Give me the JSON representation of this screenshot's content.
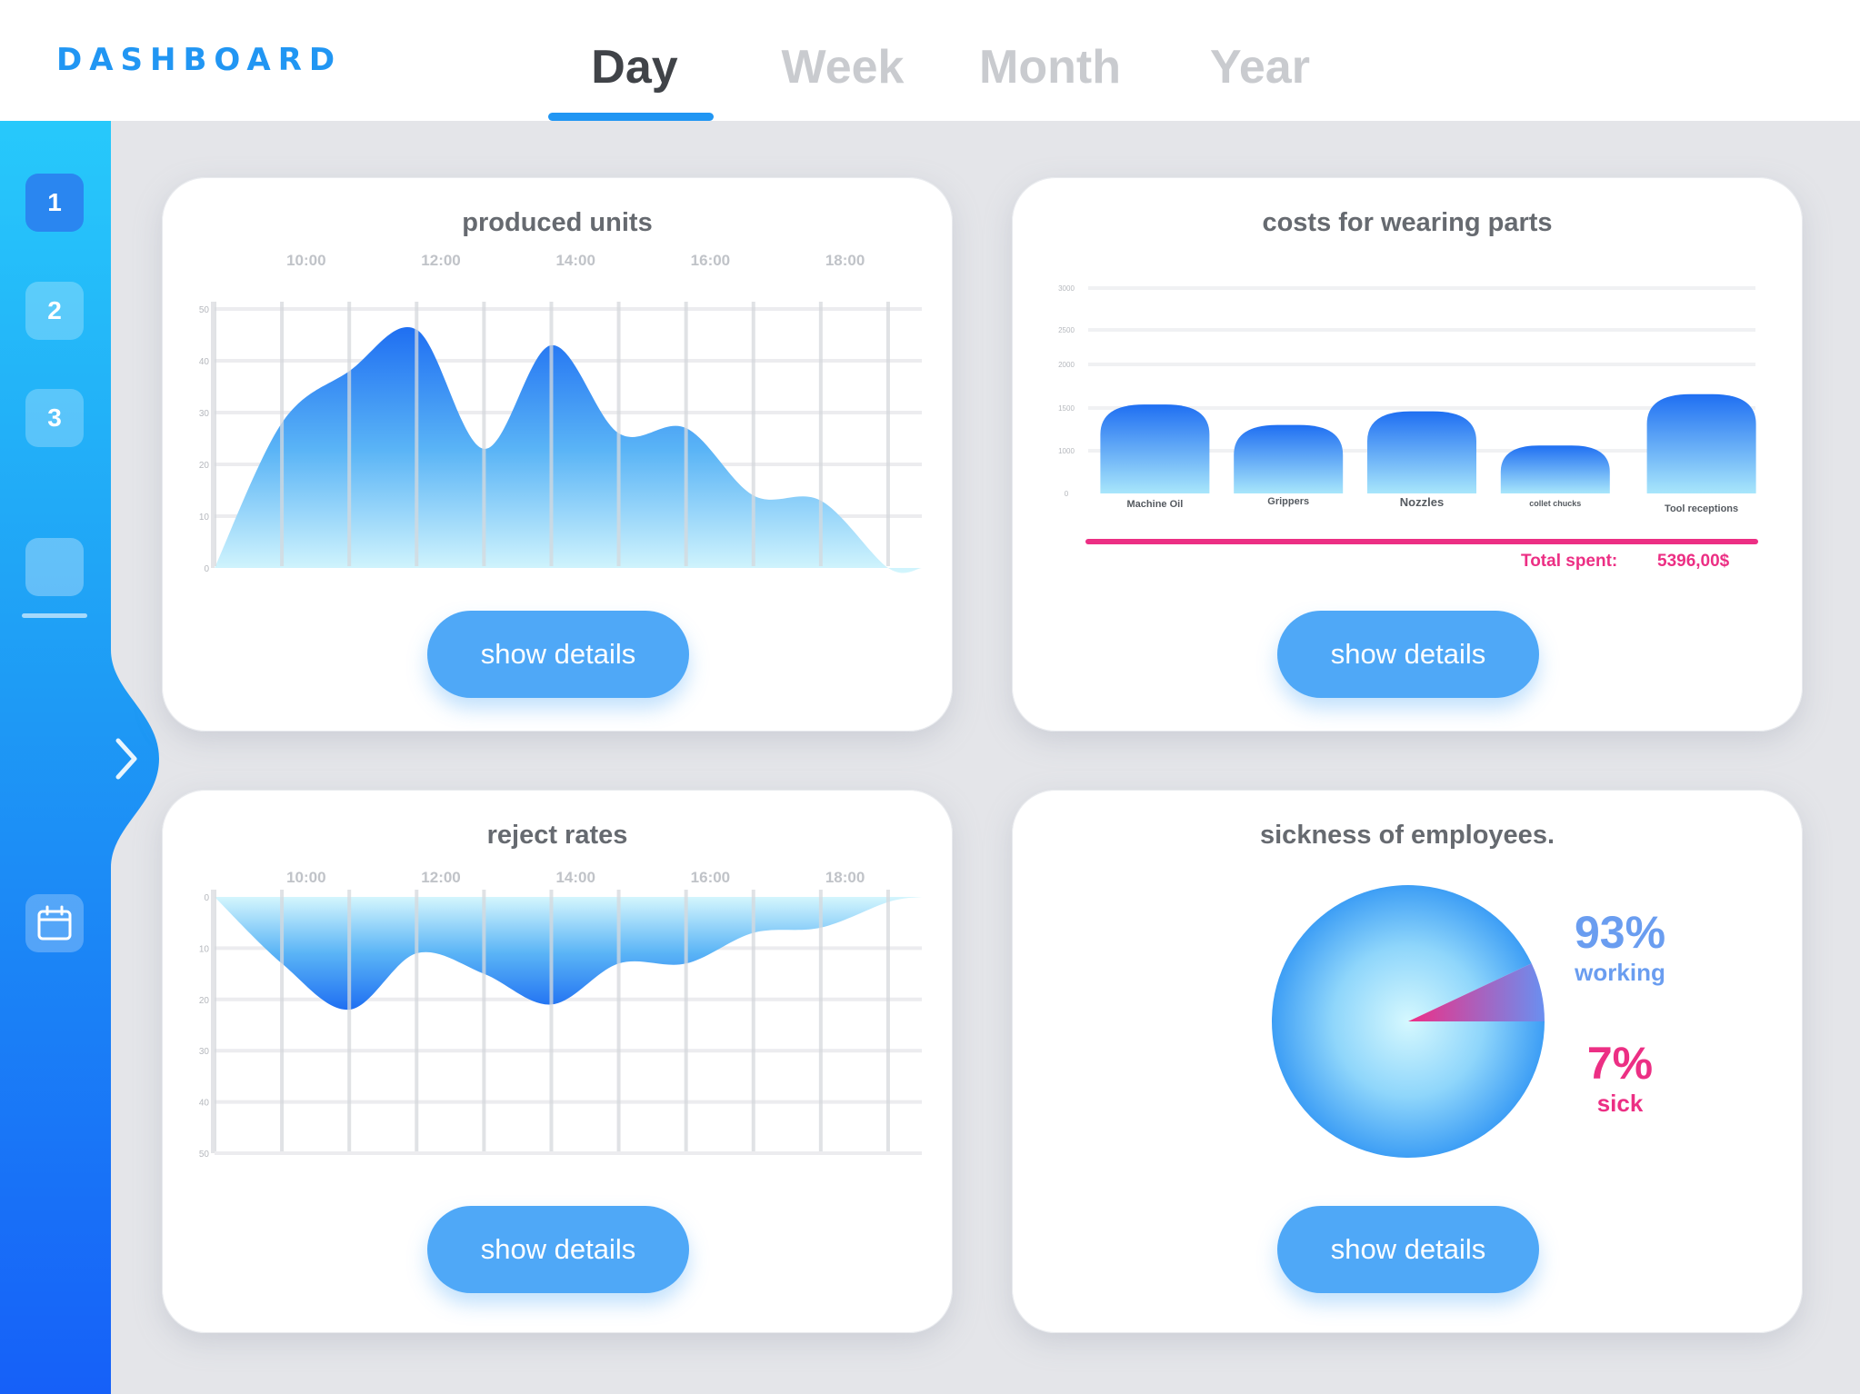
{
  "header": {
    "logo": "DASHBOARD",
    "tabs": [
      "Day",
      "Week",
      "Month",
      "Year"
    ],
    "active_tab": "Day"
  },
  "sidebar": {
    "items": [
      "1",
      "2",
      "3"
    ],
    "icons": [
      "blank-tile-icon",
      "chevron-right-icon",
      "calendar-icon"
    ]
  },
  "colors": {
    "accent": "#2196f3",
    "button": "#4fa8f7",
    "magenta": "#ec2f84",
    "working": "#6a9df0"
  },
  "buttons": {
    "show_details": "show details"
  },
  "chart_data": [
    {
      "type": "area",
      "title": "produced units",
      "x_tick_labels": [
        "10:00",
        "12:00",
        "14:00",
        "16:00",
        "18:00"
      ],
      "y_tick_labels": [
        "0",
        "10",
        "20",
        "30",
        "40",
        "50"
      ],
      "ylim": [
        0,
        50
      ],
      "x": [
        "09:00",
        "10:00",
        "11:00",
        "12:00",
        "13:00",
        "14:00",
        "15:00",
        "16:00",
        "17:00",
        "18:00",
        "19:00",
        "19:30"
      ],
      "values": [
        0,
        28,
        38,
        46,
        23,
        43,
        26,
        27,
        14,
        13,
        0,
        0
      ],
      "grid": true
    },
    {
      "type": "bar",
      "title": "costs for wearing parts",
      "categories": [
        "Machine Oil",
        "Grippers",
        "Nozzles",
        "collet chucks",
        "Tool receptions"
      ],
      "values": [
        1300,
        1000,
        1200,
        700,
        1450
      ],
      "y_tick_labels": [
        "0",
        "1000",
        "1500",
        "2000",
        "2500",
        "3000"
      ],
      "ylim": [
        0,
        3000
      ],
      "total_label": "Total spent:",
      "total_value": "5396,00$",
      "grid": true
    },
    {
      "type": "area",
      "title": "reject rates",
      "x_tick_labels": [
        "10:00",
        "12:00",
        "14:00",
        "16:00",
        "18:00"
      ],
      "y_tick_labels": [
        "0",
        "10",
        "20",
        "30",
        "40",
        "50"
      ],
      "ylim": [
        0,
        50
      ],
      "y_inverted": true,
      "x": [
        "09:00",
        "10:00",
        "11:00",
        "12:00",
        "13:00",
        "14:00",
        "15:00",
        "16:00",
        "17:00",
        "18:00",
        "19:00",
        "19:30"
      ],
      "values": [
        0,
        13,
        22,
        11,
        15,
        21,
        13,
        13,
        7,
        6,
        1,
        0
      ],
      "grid": true
    },
    {
      "type": "pie",
      "title": "sickness of employees.",
      "slices": [
        {
          "label": "working",
          "value": 93,
          "display": "93%"
        },
        {
          "label": "sick",
          "value": 7,
          "display": "7%"
        }
      ]
    }
  ]
}
